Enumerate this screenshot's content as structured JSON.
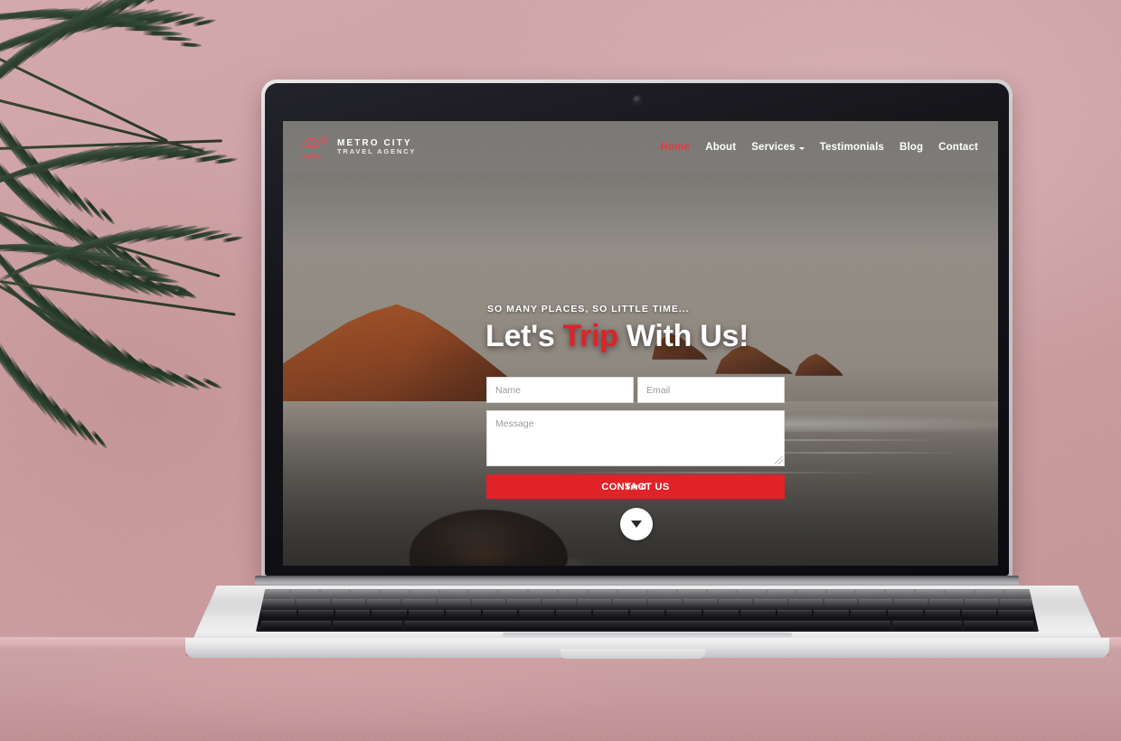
{
  "scene": {
    "description": "laptop-mockup-on-pink-table",
    "wall_color": "#cda0a3",
    "table_color": "#c6999c",
    "plant": "palm-frond"
  },
  "site": {
    "header": {
      "brand": {
        "icon": "beach-umbrella-icon",
        "line1": "METRO CITY",
        "line2": "TRAVEL AGENCY",
        "color": "#d9555c"
      },
      "nav": [
        {
          "label": "Home",
          "active": true
        },
        {
          "label": "About",
          "active": false
        },
        {
          "label": "Services",
          "active": false,
          "has_dropdown": true
        },
        {
          "label": "Testimonials",
          "active": false
        },
        {
          "label": "Blog",
          "active": false
        },
        {
          "label": "Contact",
          "active": false
        }
      ],
      "active_color": "#e23a3f",
      "link_color": "#ffffff",
      "background": "rgba(128,126,122,0.72)"
    },
    "hero": {
      "kicker": "SO MANY PLACES, SO LITTLE TIME...",
      "headline_part1": "Let's ",
      "headline_accent": "Trip",
      "headline_part2": " With Us!",
      "accent_color": "#e02229",
      "background_image": "coastal-cliffs-beach-photo"
    },
    "form": {
      "name_placeholder": "Name",
      "name_value": "",
      "email_placeholder": "Email",
      "email_value": "",
      "message_placeholder": "Message",
      "message_value": "",
      "submit_label": "CONTACT US",
      "submit_overlay_label": "Send",
      "submit_color": "#e02229"
    },
    "scroll_button": {
      "icon": "chevron-down-icon",
      "background": "#ffffff",
      "icon_color": "#2b2b2b"
    }
  }
}
